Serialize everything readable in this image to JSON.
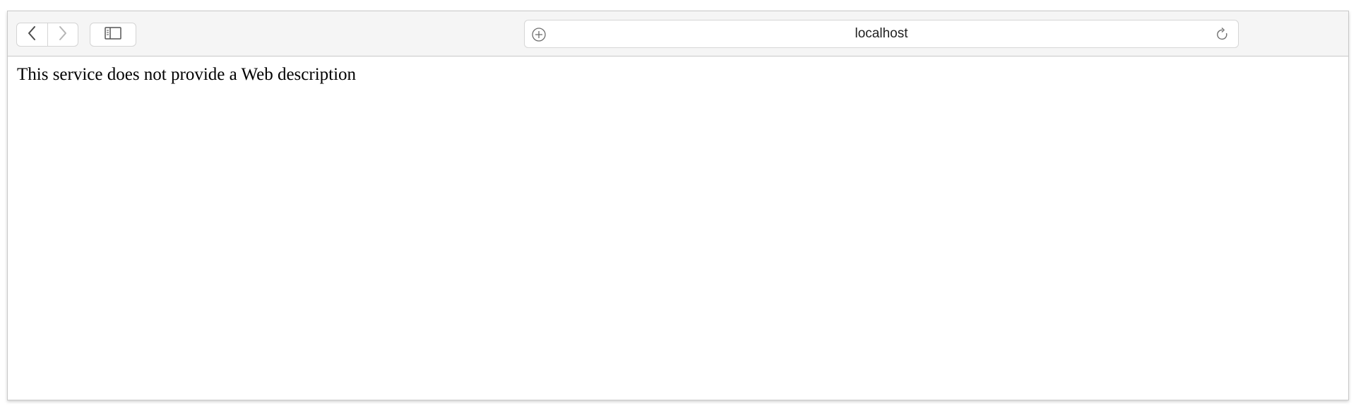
{
  "browser": {
    "address_bar": {
      "url": "localhost",
      "left_icon": "plus-circle-icon",
      "right_icon": "reload-icon"
    },
    "nav": {
      "back_icon": "chevron-left-icon",
      "forward_icon": "chevron-right-icon",
      "sidebar_icon": "sidebar-icon"
    }
  },
  "page": {
    "body_text": "This service does not provide a Web description"
  },
  "colors": {
    "toolbar_bg": "#f5f5f5",
    "border": "#c8c8c8",
    "text": "#000000"
  }
}
